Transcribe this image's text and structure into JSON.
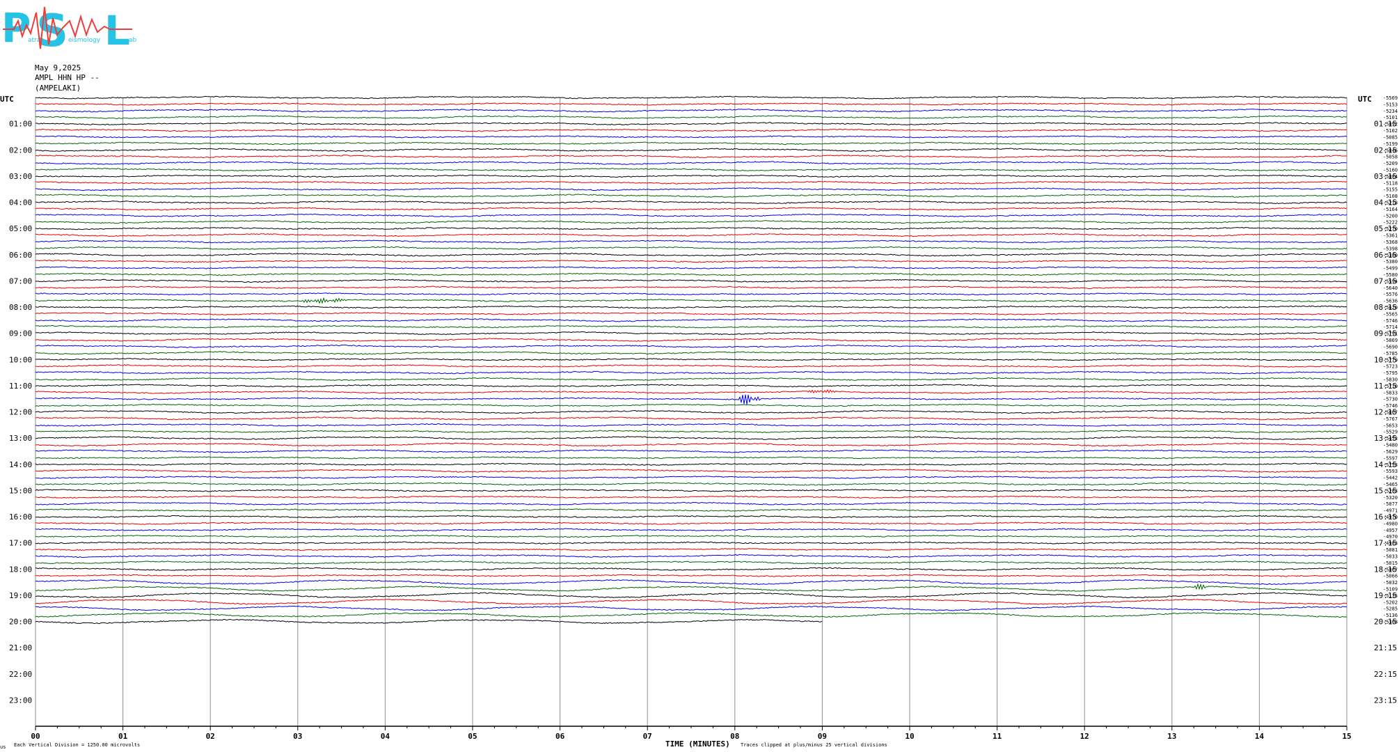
{
  "logo": {
    "letters": [
      "P",
      "S",
      "L"
    ],
    "subwords": [
      "atras",
      "eismology",
      "ab"
    ],
    "primary_color": "#27c3e6",
    "wave_color": "#ef3b3b"
  },
  "header": {
    "date": "May 9,2025",
    "channel": "AMPL HHN HP --",
    "station": "(AMPELAKI)"
  },
  "axis_left_title": "UTC",
  "axis_right_title": "UTC",
  "footer": {
    "note_left": "Each Vertical Division = 1250.00 microvolts",
    "xlabel": "TIME (MINUTES)",
    "note_right": "Traces clipped at plus/minus 25 vertical divisions",
    "corner_mark": "us"
  },
  "chart_data": {
    "type": "line",
    "title": "",
    "xlabel": "TIME (MINUTES)",
    "ylabel": "UTC",
    "xlim": [
      0,
      15
    ],
    "x_ticks": [
      "00",
      "01",
      "02",
      "03",
      "04",
      "05",
      "06",
      "07",
      "08",
      "09",
      "10",
      "11",
      "12",
      "13",
      "14",
      "15"
    ],
    "minutes_per_row": 15,
    "rows_total": 96,
    "rows_recorded": 81,
    "last_row_end_minute": 9,
    "trace_colors": [
      "#000000",
      "#ee0000",
      "#0000ee",
      "#006600"
    ],
    "left_hour_labels": [
      "01:00",
      "02:00",
      "03:00",
      "04:00",
      "05:00",
      "06:00",
      "07:00",
      "08:00",
      "09:00",
      "10:00",
      "11:00",
      "12:00",
      "13:00",
      "14:00",
      "15:00",
      "16:00",
      "17:00",
      "18:00",
      "19:00",
      "20:00",
      "21:00",
      "22:00",
      "23:00"
    ],
    "right_hour_labels": [
      "01:15",
      "02:15",
      "03:15",
      "04:15",
      "05:15",
      "06:15",
      "07:15",
      "08:15",
      "09:15",
      "10:15",
      "11:15",
      "12:15",
      "13:15",
      "14:15",
      "15:15",
      "16:15",
      "17:15",
      "18:15",
      "19:15",
      "20:15",
      "21:15",
      "22:15",
      "23:15"
    ],
    "row_offsets": [
      "-5569",
      "-5153",
      "-5234",
      "-5101",
      "-5092",
      "-5102",
      "-5085",
      "-5199",
      "-5046",
      "-5058",
      "-5209",
      "-5160",
      "-5084",
      "-5118",
      "-5155",
      "-5108",
      "-5218",
      "-5164",
      "-5200",
      "-5222",
      "-5270",
      "-5361",
      "-5368",
      "-5398",
      "-5380",
      "-5380",
      "-5499",
      "-5580",
      "-5594",
      "-5640",
      "-5576",
      "-5636",
      "-5620",
      "-5565",
      "-5746",
      "-5714",
      "-5791",
      "-5869",
      "-5690",
      "-5785",
      "-5779",
      "-5723",
      "-5795",
      "-5830",
      "-5710",
      "-5833",
      "-5730",
      "-5746",
      "-5807",
      "-5767",
      "-5653",
      "-5529",
      "-5453",
      "-5480",
      "-5629",
      "-5597",
      "-5753",
      "-5593",
      "-5442",
      "-5465",
      "-5283",
      "-5320",
      "-5077",
      "-4971",
      "-4970",
      "-4980",
      "-4957",
      "-4970",
      "-4983",
      "-5081",
      "-5033",
      "-5015",
      "-5067",
      "-5066",
      "-5032",
      "-5109",
      "-5135",
      "-5202",
      "-5285",
      "-5136",
      "-5308"
    ],
    "events": [
      {
        "row": 31,
        "minute_start": 3.0,
        "minute_end": 3.6,
        "amplitude": 2.2
      },
      {
        "row": 46,
        "minute_start": 8.0,
        "minute_end": 8.3,
        "amplitude": 5.5
      },
      {
        "row": 45,
        "minute_start": 8.8,
        "minute_end": 9.2,
        "amplitude": 1.6
      },
      {
        "row": 75,
        "minute_start": 13.2,
        "minute_end": 13.4,
        "amplitude": 3.0
      }
    ]
  }
}
